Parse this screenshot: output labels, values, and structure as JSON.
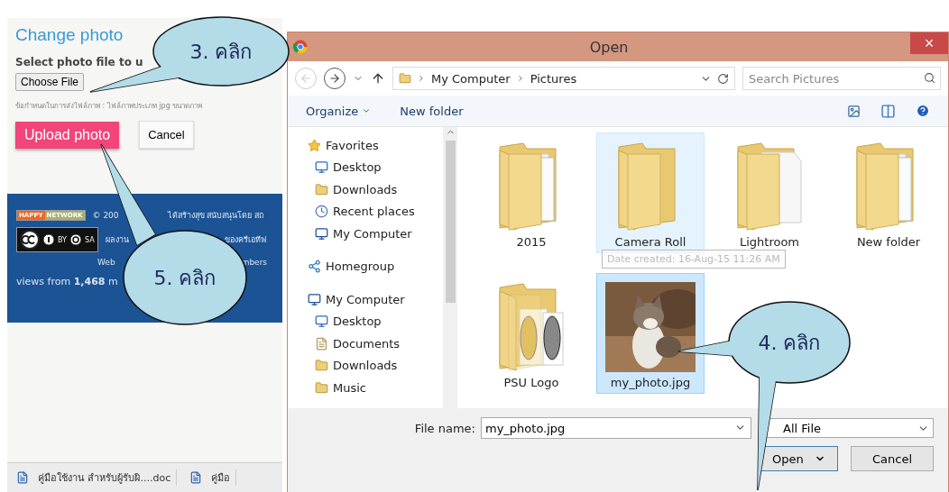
{
  "page": {
    "heading": "Change photo",
    "label": "Select photo file to u",
    "choose_button": "Choose File",
    "hint": "ข้อกำหนดในการส่งไฟล์ภาพ : ไฟล์ภาพประเภท jpg ขนาดภาพ",
    "upload_button": "Upload photo",
    "cancel_button": "Cancel"
  },
  "footer": {
    "badge": [
      "HAPPY",
      "NETWORK"
    ],
    "cc_labels": [
      "BY",
      "SA"
    ],
    "lines": [
      [
        "© 200",
        "ได้สร้างสุข สนับสนุนโดย สถ"
      ],
      [
        "ผลงาน",
        "ของครีเอทีฟ"
      ],
      [
        "Web",
        "mbers"
      ]
    ],
    "views": "views from **1,468** m"
  },
  "taskbar": [
    {
      "label": "คู่มือใช้งาน สำหรับผู้รับผิ....doc"
    },
    {
      "label": "คู่มือ"
    }
  ],
  "dialog": {
    "title": "Open",
    "close": "×",
    "breadcrumb": [
      "My Computer",
      "Pictures"
    ],
    "search_placeholder": "Search Pictures",
    "toolbar": [
      "Organize",
      "New folder"
    ],
    "nav": [
      {
        "label": "Favorites",
        "kind": "star",
        "children": [
          {
            "label": "Desktop",
            "kind": "desktop"
          },
          {
            "label": "Downloads",
            "kind": "downloads"
          },
          {
            "label": "Recent places",
            "kind": "recent"
          },
          {
            "label": "My Computer",
            "kind": "computer"
          }
        ]
      },
      {
        "label": "Homegroup",
        "kind": "homegroup"
      },
      {
        "label": "My Computer",
        "kind": "computer",
        "children": [
          {
            "label": "Desktop",
            "kind": "desktop"
          },
          {
            "label": "Documents",
            "kind": "documents"
          },
          {
            "label": "Downloads",
            "kind": "downloads"
          },
          {
            "label": "Music",
            "kind": "downloads"
          }
        ]
      }
    ],
    "items": [
      {
        "label": "2015",
        "kind": "folder",
        "selected": false,
        "hovered": false
      },
      {
        "label": "Camera Roll",
        "kind": "empty",
        "selected": false,
        "hovered": true
      },
      {
        "label": "Lightroom",
        "kind": "document",
        "selected": false,
        "hovered": false
      },
      {
        "label": "New folder",
        "kind": "folder",
        "selected": false,
        "hovered": false
      },
      {
        "label": "PSU Logo",
        "kind": "emblem",
        "selected": false,
        "hovered": false
      },
      {
        "label": "my_photo.jpg",
        "selected": true,
        "hovered": false
      }
    ],
    "tooltip": "Date created: 16-Aug-15 11:26 AM",
    "file_name_label": "File name:",
    "file_name": "my_photo.jpg",
    "file_type": "All File",
    "buttons": [
      "Open",
      "Cancel"
    ]
  },
  "callouts": [
    {
      "text": "3. คลิก"
    },
    {
      "text": "4. คลิก"
    },
    {
      "text": "5. คลิก"
    }
  ]
}
